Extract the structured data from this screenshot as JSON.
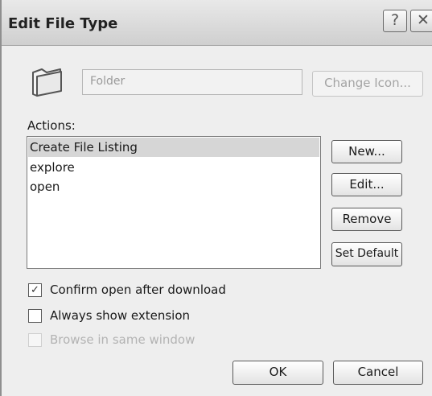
{
  "window": {
    "title": "Edit File Type",
    "help_symbol": "?",
    "close_symbol": "✕"
  },
  "file_type": {
    "icon": "folder-icon",
    "description": "Folder",
    "change_icon_label": "Change Icon..."
  },
  "actions": {
    "label": "Actions:",
    "items": [
      {
        "label": "Create File Listing",
        "selected": true
      },
      {
        "label": "explore",
        "selected": false
      },
      {
        "label": "open",
        "selected": false
      }
    ],
    "buttons": {
      "new": "New...",
      "edit": "Edit...",
      "remove": "Remove",
      "set_default": "Set Default"
    }
  },
  "options": [
    {
      "label": "Confirm open after download",
      "checked": true,
      "enabled": true
    },
    {
      "label": "Always show extension",
      "checked": false,
      "enabled": true
    },
    {
      "label": "Browse in same window",
      "checked": false,
      "enabled": false
    }
  ],
  "footer": {
    "ok": "OK",
    "cancel": "Cancel"
  }
}
